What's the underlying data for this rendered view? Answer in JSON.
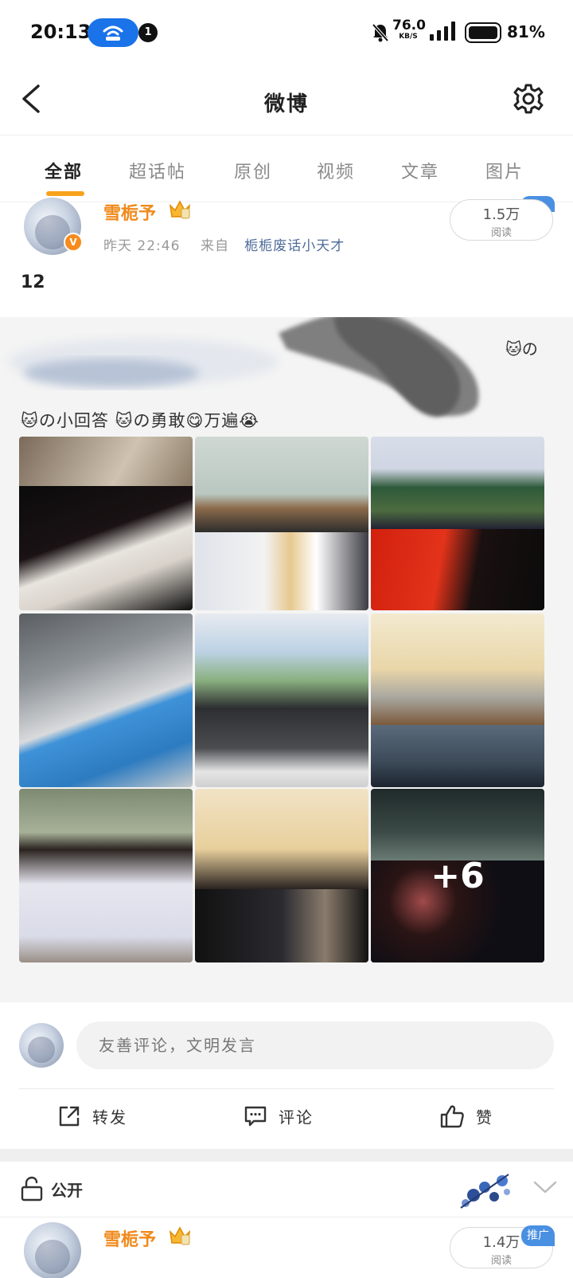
{
  "status_bar": {
    "time": "20:13",
    "notification_count": "1",
    "net_speed_value": "76.0",
    "net_speed_unit": "KB/S",
    "battery_percent": "81%"
  },
  "nav": {
    "title": "微博"
  },
  "tabs": [
    {
      "label": "全部",
      "active": true
    },
    {
      "label": "超话帖"
    },
    {
      "label": "原创"
    },
    {
      "label": "视频"
    },
    {
      "label": "文章"
    },
    {
      "label": "图片"
    }
  ],
  "post": {
    "author": "雪栀予",
    "time": "昨天 22:46",
    "from_prefix": "来自",
    "source": "栀栀废话小天才",
    "reads": "1.5万",
    "reads_label": "阅读",
    "text": "12",
    "repost": {
      "emoji_tail": "🐱の",
      "line": "🐱の小回答 🐱の勇敢😋万遍😭"
    },
    "images": {
      "count_shown": 9,
      "more_count": "+6"
    }
  },
  "comment": {
    "placeholder": "友善评论，文明发言"
  },
  "actions": {
    "repost": "转发",
    "comment": "评论",
    "like": "赞"
  },
  "visibility": {
    "label": "公开"
  },
  "post2": {
    "author": "雪栀予",
    "reads": "1.4万",
    "reads_label": "阅读",
    "promo": "推广"
  },
  "colors": {
    "accent_orange": "#f7a21b",
    "username_orange": "#f08a1c",
    "source_blue": "#4f6c9a",
    "hotspot_blue": "#1a73e8"
  }
}
